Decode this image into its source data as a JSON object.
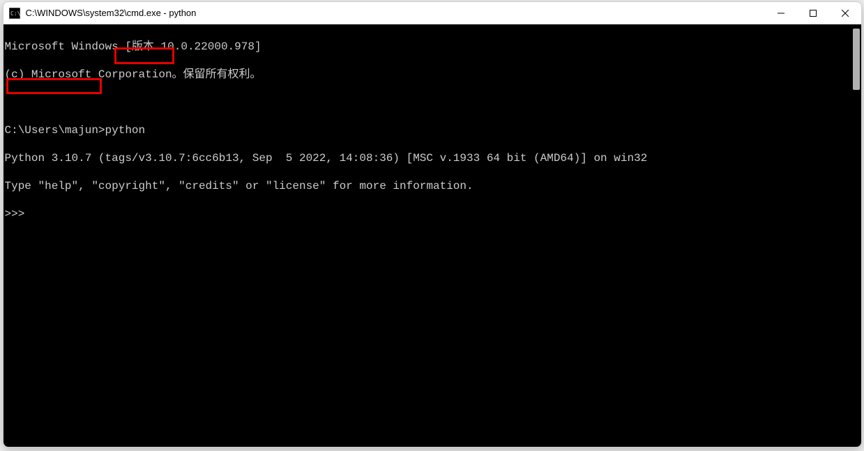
{
  "title_bar": {
    "title": "C:\\WINDOWS\\system32\\cmd.exe - python"
  },
  "terminal": {
    "lines": {
      "l0": "Microsoft Windows [版本 10.0.22000.978]",
      "l1": "(c) Microsoft Corporation。保留所有权利。",
      "l2": "",
      "l3": "C:\\Users\\majun>python",
      "l4": "Python 3.10.7 (tags/v3.10.7:6cc6b13, Sep  5 2022, 14:08:36) [MSC v.1933 64 bit (AMD64)] on win32",
      "l5": "Type \"help\", \"copyright\", \"credits\" or \"license\" for more information.",
      "l6": ">>>"
    }
  },
  "annotations": {
    "highlight_command": "python",
    "highlight_version": "Python 3.10.7"
  }
}
